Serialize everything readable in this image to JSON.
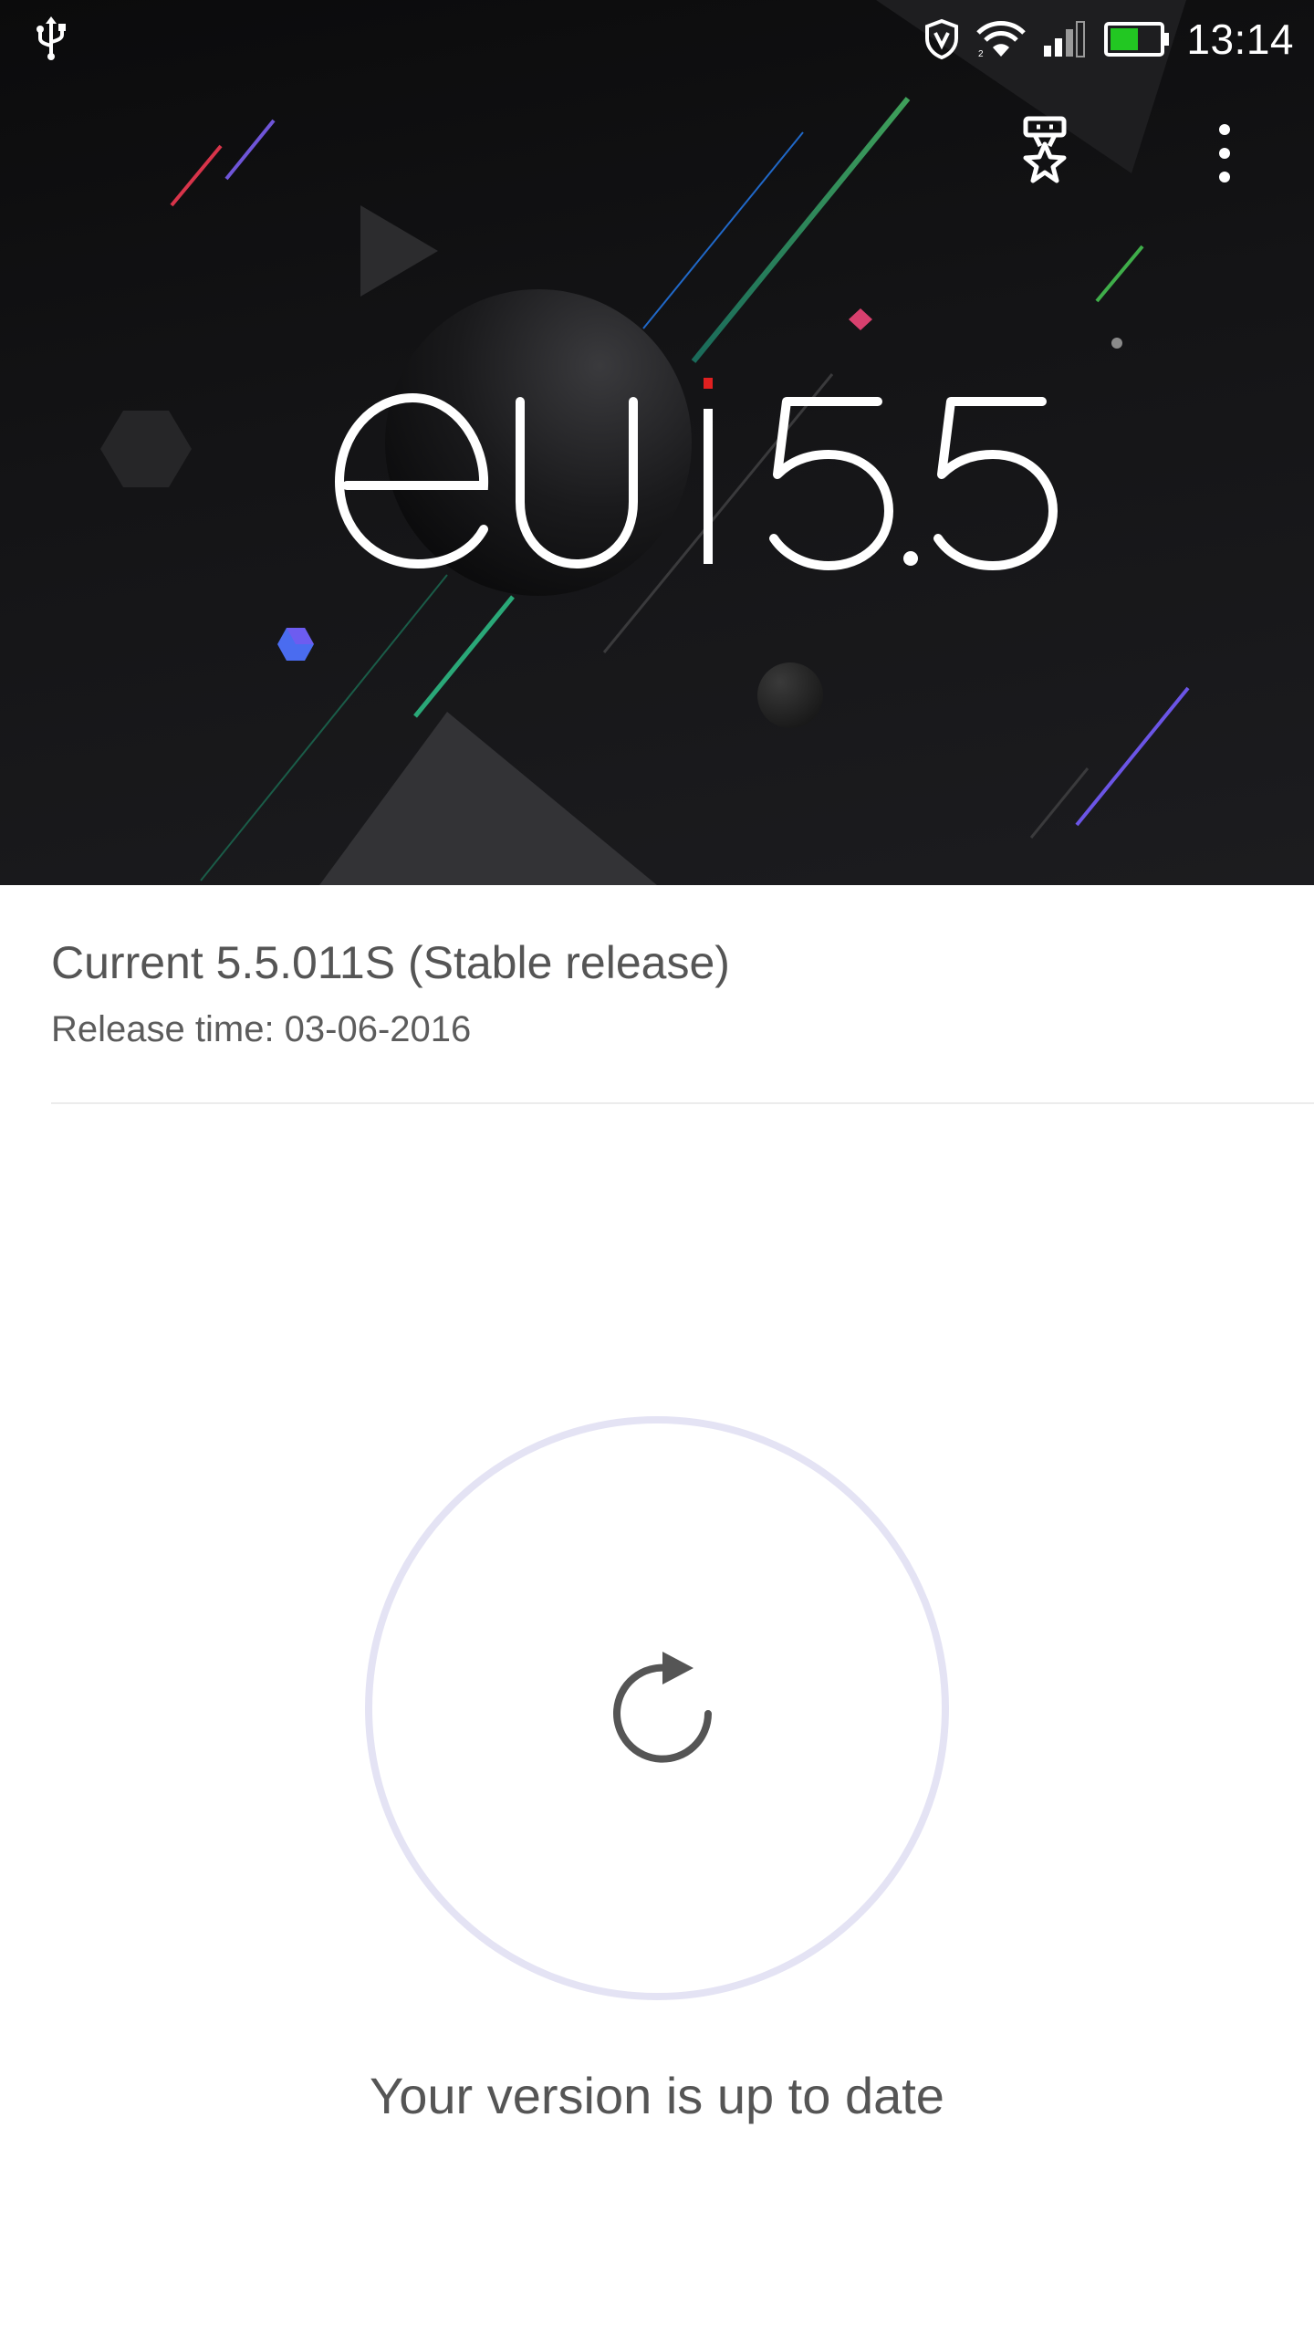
{
  "status_bar": {
    "time": "13:14",
    "icons": [
      "usb-icon",
      "vpn-shield-icon",
      "wifi-icon",
      "signal-icon",
      "battery-icon"
    ],
    "battery_color": "#22c722"
  },
  "action_bar": {
    "icons": [
      "award-icon",
      "more-vert-icon"
    ]
  },
  "hero": {
    "logo_text": "eui",
    "logo_version": "5.5",
    "logo_accent": "#e02020"
  },
  "update": {
    "current_version": "Current 5.5.011S (Stable release)",
    "release_time": "Release time: 03-06-2016"
  },
  "check": {
    "button_icon": "refresh-icon",
    "ring_color": "#e4e3f4",
    "message": "Your version is up to date"
  }
}
